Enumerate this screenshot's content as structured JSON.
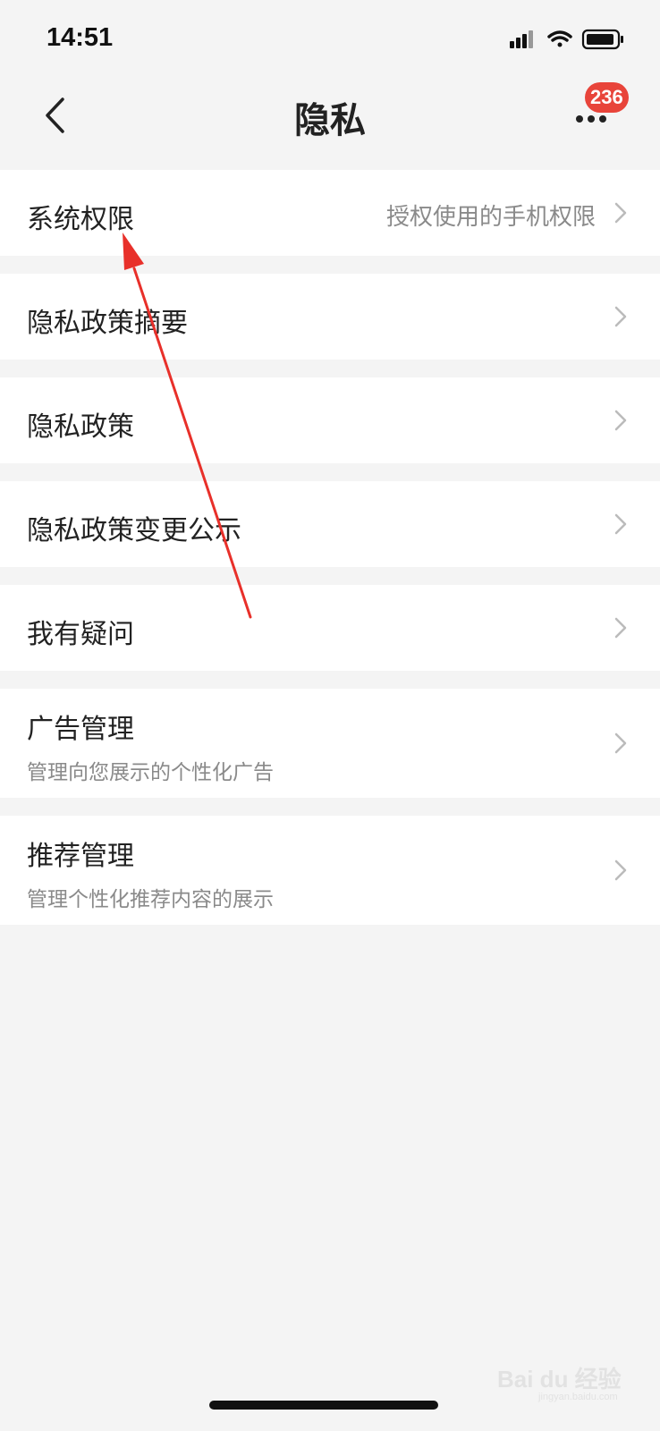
{
  "status_bar": {
    "time": "14:51",
    "icons": [
      "signal-icon",
      "wifi-icon",
      "battery-icon"
    ]
  },
  "header": {
    "title": "隐私",
    "back_icon": "chevron-left-icon",
    "more_icon": "more-dots-icon",
    "badge_count": "236",
    "badge_color": "#e8443a"
  },
  "items": [
    {
      "title": "系统权限",
      "value": "授权使用的手机权限",
      "subtitle": ""
    },
    {
      "title": "隐私政策摘要",
      "value": "",
      "subtitle": ""
    },
    {
      "title": "隐私政策",
      "value": "",
      "subtitle": ""
    },
    {
      "title": "隐私政策变更公示",
      "value": "",
      "subtitle": ""
    },
    {
      "title": "我有疑问",
      "value": "",
      "subtitle": ""
    },
    {
      "title": "广告管理",
      "value": "",
      "subtitle": "管理向您展示的个性化广告"
    },
    {
      "title": "推荐管理",
      "value": "",
      "subtitle": "管理个性化推荐内容的展示"
    }
  ],
  "annotation": {
    "type": "red-arrow",
    "color": "#e8302a"
  },
  "watermark": {
    "text": "Bai du 经验",
    "sub": "jingyan.baidu.com"
  }
}
